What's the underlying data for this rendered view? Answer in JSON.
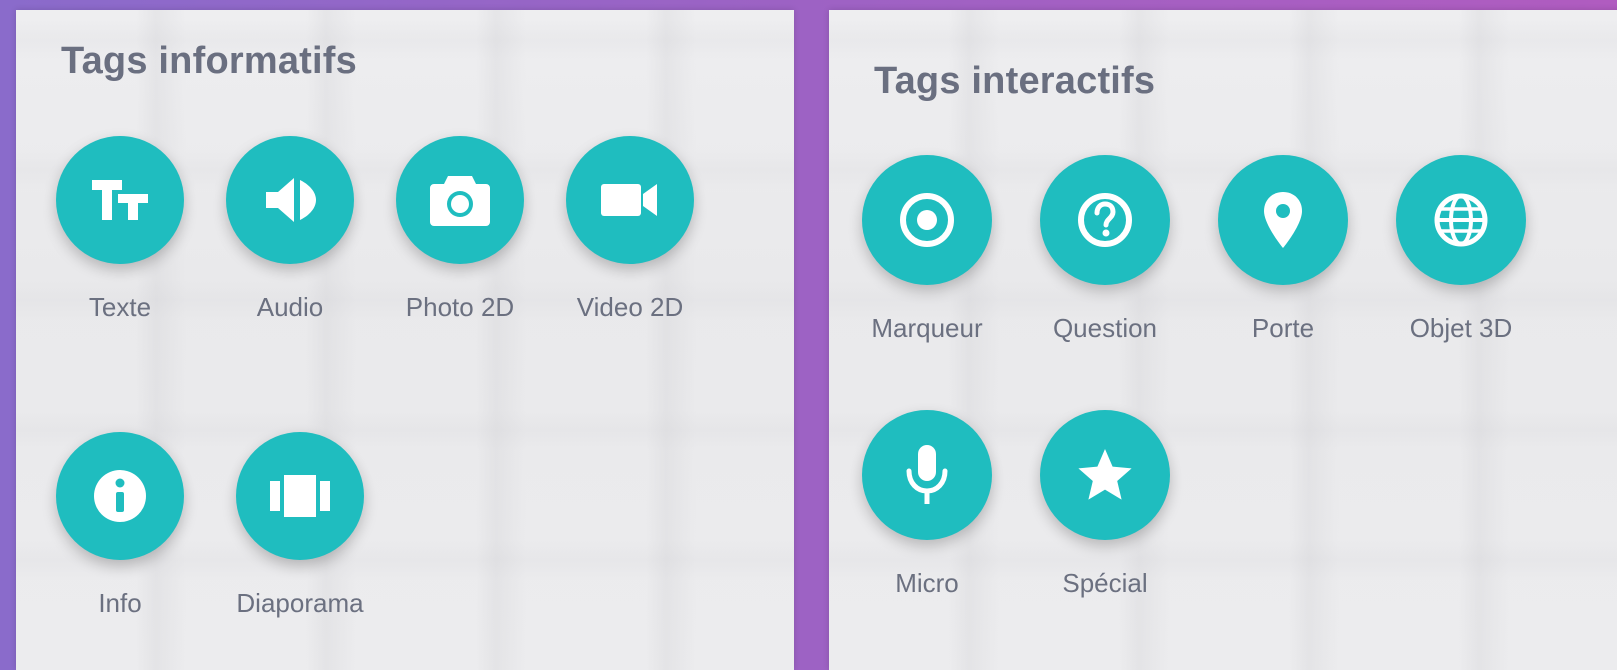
{
  "informatifs": {
    "title": "Tags informatifs",
    "items": [
      {
        "label": "Texte",
        "icon": "text-icon"
      },
      {
        "label": "Audio",
        "icon": "audio-icon"
      },
      {
        "label": "Photo 2D",
        "icon": "camera-icon"
      },
      {
        "label": "Video 2D",
        "icon": "video-icon"
      },
      {
        "label": "Info",
        "icon": "info-icon"
      },
      {
        "label": "Diaporama",
        "icon": "slideshow-icon"
      }
    ]
  },
  "interactifs": {
    "title": "Tags interactifs",
    "items": [
      {
        "label": "Marqueur",
        "icon": "marker-icon"
      },
      {
        "label": "Question",
        "icon": "question-icon"
      },
      {
        "label": "Porte",
        "icon": "location-pin-icon"
      },
      {
        "label": "Objet 3D",
        "icon": "globe-icon"
      },
      {
        "label": "Micro",
        "icon": "microphone-icon"
      },
      {
        "label": "Spécial",
        "icon": "star-icon"
      }
    ]
  },
  "colors": {
    "accent": "#1fbdbf",
    "text": "#6b7080",
    "background_gradient_start": "#8a6bcb",
    "background_gradient_end": "#b05cc0"
  }
}
